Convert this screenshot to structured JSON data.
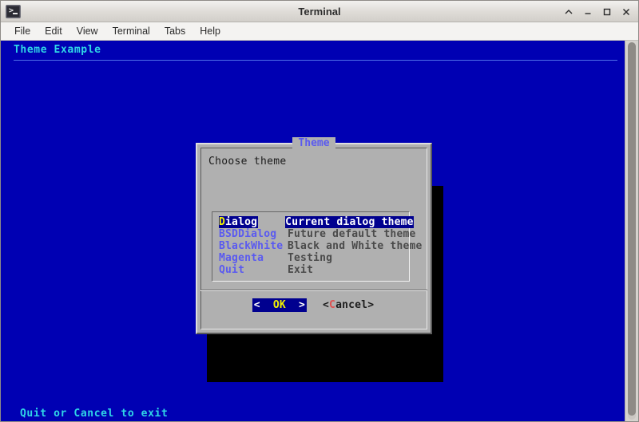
{
  "window": {
    "title": "Terminal",
    "icon": "terminal-icon",
    "controls": [
      {
        "name": "shade-button",
        "glyph": "^"
      },
      {
        "name": "minimize-button",
        "glyph": "_"
      },
      {
        "name": "maximize-button",
        "glyph": "□"
      },
      {
        "name": "close-button",
        "glyph": "✕"
      }
    ]
  },
  "menubar": {
    "items": [
      {
        "label": "File"
      },
      {
        "label": "Edit"
      },
      {
        "label": "View"
      },
      {
        "label": "Terminal"
      },
      {
        "label": "Tabs"
      },
      {
        "label": "Help"
      }
    ]
  },
  "terminal": {
    "background_color": "#0000b3",
    "heading": "Theme Example",
    "footer": "Quit or Cancel to exit",
    "heading_color": "#2fd6e6",
    "rule_color": "#4f6fe8"
  },
  "dialog": {
    "title": "Theme",
    "title_color": "#5a5af0",
    "prompt": "Choose theme",
    "background_color": "#b0b0b0",
    "highlight_color": "#00008f",
    "hotkey_color": "#f2f200",
    "menu": [
      {
        "tag": "Dialog",
        "hotkey": "D",
        "rest": "ialog",
        "desc": "Current dialog theme",
        "selected": true
      },
      {
        "tag": "BSDDialog",
        "hotkey": "B",
        "rest": "SDDialog",
        "desc": "Future default theme",
        "selected": false
      },
      {
        "tag": "BlackWhite",
        "hotkey": "B",
        "rest": "lackWhite",
        "desc": "Black and White theme",
        "selected": false
      },
      {
        "tag": "Magenta",
        "hotkey": "M",
        "rest": "agenta",
        "desc": "Testing",
        "selected": false
      },
      {
        "tag": "Quit",
        "hotkey": "Q",
        "rest": "uit",
        "desc": "Exit",
        "selected": false
      }
    ],
    "buttons": {
      "ok": {
        "left": "<  ",
        "label": "OK",
        "right": "  >"
      },
      "cancel": {
        "prefix": "<",
        "hotkey": "C",
        "suffix": "ancel>"
      }
    }
  }
}
